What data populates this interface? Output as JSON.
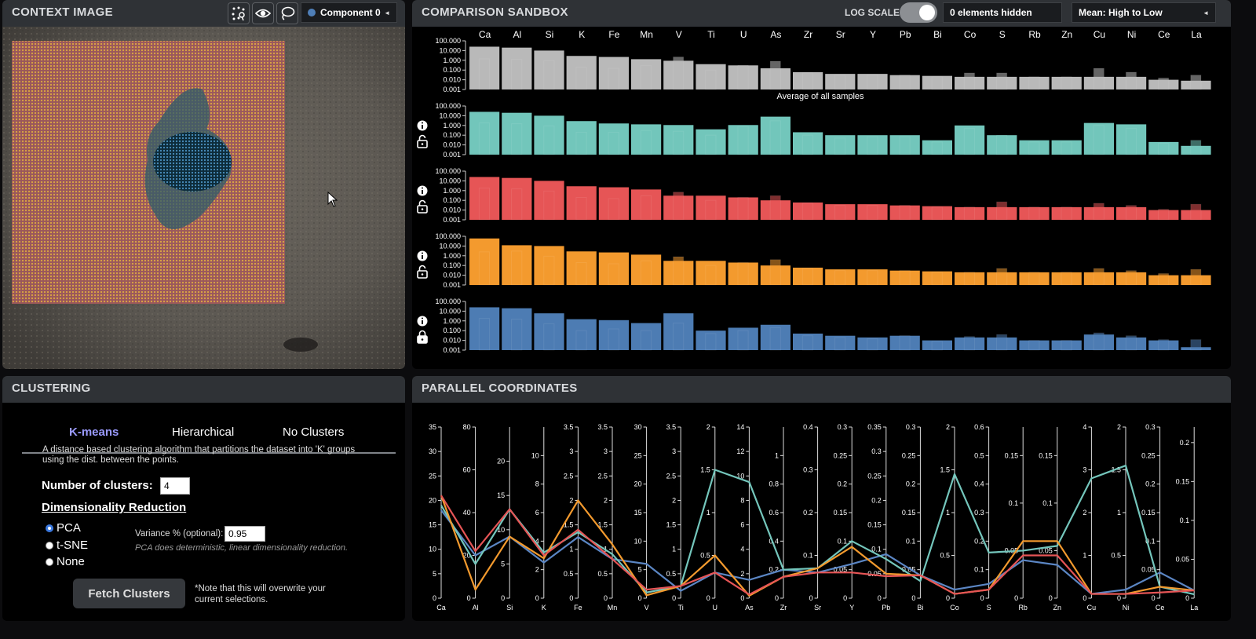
{
  "context": {
    "title": "CONTEXT IMAGE",
    "component_select": "Component 0",
    "component_color": "#4f7fb8"
  },
  "sandbox": {
    "title": "COMPARISON SANDBOX",
    "log_scale_label": "LOG SCALE",
    "log_scale_on": true,
    "hidden_label": "0 elements hidden",
    "sort_select": "Mean: High to Low",
    "avg_caption": "Average of all samples"
  },
  "clustering": {
    "title": "CLUSTERING",
    "tabs": [
      "K-means",
      "Hierarchical",
      "No Clusters"
    ],
    "active_tab": 0,
    "description": [
      "A distance based clustering algorithm that partitions the dataset into 'K' groups",
      "using the dist. between the points."
    ],
    "num_clusters_label": "Number of clusters:",
    "num_clusters_value": "4",
    "dimred_label": "Dimensionality Reduction",
    "options": [
      "PCA",
      "t-SNE",
      "None"
    ],
    "selected_option": 0,
    "variance_label": "Variance % (optional):",
    "variance_value": "0.95",
    "pca_note": "PCA does deterministic, linear dimensionality reduction.",
    "fetch_button": "Fetch Clusters",
    "note_lines": [
      "*Note that this will overwrite your",
      "current selections."
    ]
  },
  "parallel": {
    "title": "PARALLEL COORDINATES"
  },
  "chart_data": [
    {
      "type": "bar",
      "title": "COMPARISON SANDBOX",
      "log_scale": true,
      "y_ticks": [
        "100.000",
        "10.000",
        "1.000",
        "0.100",
        "0.010",
        "0.001"
      ],
      "ylim": [
        0.001,
        100
      ],
      "categories": [
        "Ca",
        "Al",
        "Si",
        "K",
        "Fe",
        "Mn",
        "V",
        "Ti",
        "U",
        "As",
        "Zr",
        "Sr",
        "Y",
        "Pb",
        "Bi",
        "Co",
        "S",
        "Rb",
        "Zn",
        "Cu",
        "Ni",
        "Ce",
        "La"
      ],
      "series": [
        {
          "color": "#b9b9b9",
          "mean": [
            25,
            20,
            10,
            2.8,
            2.2,
            1.3,
            0.9,
            0.4,
            0.3,
            0.15,
            0.06,
            0.04,
            0.04,
            0.03,
            0.025,
            0.02,
            0.02,
            0.02,
            0.02,
            0.02,
            0.02,
            0.01,
            0.008
          ],
          "inner": [
            1.4,
            1.2,
            0.9,
            0.2,
            0.15,
            0.3,
            2.2,
            0.1,
            0.3,
            0.8,
            0.05,
            0.03,
            0.03,
            0.03,
            0.02,
            0.05,
            0.05,
            0.02,
            0.02,
            0.15,
            0.06,
            0.015,
            0.03
          ]
        },
        {
          "color": "#72c6bb",
          "mean": [
            25,
            20,
            10,
            2.8,
            1.6,
            1.3,
            1.1,
            0.4,
            1.1,
            8,
            0.2,
            0.1,
            0.1,
            0.1,
            0.03,
            1,
            0.1,
            0.03,
            0.03,
            1.8,
            1.3,
            0.02,
            0.008
          ],
          "inner": [
            1.8,
            1.5,
            0.9,
            0.2,
            0.2,
            0.3,
            0.25,
            0.1,
            0.8,
            3,
            0.1,
            0.05,
            0.07,
            0.07,
            0.02,
            0.5,
            0.1,
            0.02,
            0.02,
            1,
            0.5,
            0.015,
            0.03
          ]
        },
        {
          "color": "#e65556",
          "mean": [
            25,
            20,
            10,
            2.8,
            2.2,
            1.3,
            0.3,
            0.3,
            0.2,
            0.1,
            0.06,
            0.04,
            0.04,
            0.03,
            0.025,
            0.02,
            0.02,
            0.02,
            0.02,
            0.02,
            0.02,
            0.01,
            0.01
          ],
          "inner": [
            1.8,
            1.5,
            0.9,
            0.2,
            0.15,
            0.3,
            0.7,
            0.1,
            0.2,
            0.3,
            0.05,
            0.03,
            0.03,
            0.03,
            0.02,
            0.02,
            0.07,
            0.02,
            0.02,
            0.05,
            0.03,
            0.012,
            0.04
          ]
        },
        {
          "color": "#f39a2e",
          "mean": [
            60,
            12,
            10,
            2.8,
            2.2,
            1.3,
            0.3,
            0.3,
            0.2,
            0.1,
            0.06,
            0.04,
            0.04,
            0.03,
            0.025,
            0.02,
            0.02,
            0.02,
            0.02,
            0.02,
            0.02,
            0.01,
            0.01
          ],
          "inner": [
            2.5,
            3,
            0.9,
            0.2,
            0.15,
            0.3,
            0.8,
            0.1,
            0.2,
            0.4,
            0.05,
            0.03,
            0.03,
            0.03,
            0.02,
            0.02,
            0.05,
            0.02,
            0.02,
            0.05,
            0.03,
            0.015,
            0.04
          ]
        },
        {
          "color": "#4d7cb3",
          "mean": [
            25,
            20,
            6,
            1.5,
            1.2,
            0.6,
            6,
            0.1,
            0.2,
            0.4,
            0.05,
            0.03,
            0.02,
            0.03,
            0.01,
            0.02,
            0.02,
            0.01,
            0.01,
            0.04,
            0.02,
            0.01,
            0.002
          ],
          "inner": [
            1.8,
            1.5,
            0.5,
            0.1,
            0.15,
            0.1,
            0.6,
            0.05,
            0.1,
            0.2,
            0.03,
            0.02,
            0.015,
            0.03,
            0.008,
            0.025,
            0.04,
            0.01,
            0.01,
            0.06,
            0.03,
            0.012,
            0.012
          ]
        }
      ]
    },
    {
      "type": "line",
      "title": "PARALLEL COORDINATES",
      "axes": [
        {
          "label": "Ca",
          "max": 35,
          "ticks": [
            35,
            30,
            25,
            20,
            15,
            10,
            5,
            0
          ]
        },
        {
          "label": "Al",
          "max": 80,
          "ticks": [
            80,
            60,
            40,
            20,
            0
          ]
        },
        {
          "label": "Si",
          "max": 25,
          "ticks": [
            20,
            15,
            10,
            5,
            0
          ]
        },
        {
          "label": "K",
          "max": 12,
          "ticks": [
            10,
            8,
            6,
            4,
            2,
            0
          ]
        },
        {
          "label": "Fe",
          "max": 3.5,
          "ticks": [
            3.5,
            3.0,
            2.5,
            2.0,
            1.5,
            1.0,
            0.5,
            0.0
          ]
        },
        {
          "label": "Mn",
          "max": 3.5,
          "ticks": [
            3.5,
            3.0,
            2.5,
            2.0,
            1.5,
            1.0,
            0.5,
            0.0
          ]
        },
        {
          "label": "V",
          "max": 30,
          "ticks": [
            30,
            25,
            20,
            15,
            10,
            5,
            0
          ]
        },
        {
          "label": "Ti",
          "max": 3.5,
          "ticks": [
            3.5,
            3.0,
            2.5,
            2.0,
            1.5,
            1.0,
            0.5,
            0.0
          ]
        },
        {
          "label": "U",
          "max": 2.0,
          "ticks": [
            2.0,
            1.5,
            1.0,
            0.5,
            0.0
          ]
        },
        {
          "label": "As",
          "max": 14,
          "ticks": [
            14,
            12,
            10,
            8,
            6,
            4,
            2,
            0
          ]
        },
        {
          "label": "Zr",
          "max": 1.2,
          "ticks": [
            1.0,
            0.8,
            0.6,
            0.4,
            0.2,
            0.0
          ]
        },
        {
          "label": "Sr",
          "max": 0.4,
          "ticks": [
            0.4,
            0.3,
            0.2,
            0.1,
            0.0
          ]
        },
        {
          "label": "Y",
          "max": 0.3,
          "ticks": [
            0.3,
            0.25,
            0.2,
            0.15,
            0.1,
            0.05,
            0.0
          ]
        },
        {
          "label": "Pb",
          "max": 0.35,
          "ticks": [
            0.35,
            0.3,
            0.25,
            0.2,
            0.15,
            0.1,
            0.05,
            0.0
          ]
        },
        {
          "label": "Bi",
          "max": 0.3,
          "ticks": [
            0.3,
            0.25,
            0.2,
            0.15,
            0.1,
            0.05,
            0.0
          ]
        },
        {
          "label": "Co",
          "max": 2.0,
          "ticks": [
            2.0,
            1.5,
            1.0,
            0.5,
            0.0
          ]
        },
        {
          "label": "S",
          "max": 0.6,
          "ticks": [
            0.6,
            0.5,
            0.4,
            0.3,
            0.2,
            0.1,
            0.0
          ]
        },
        {
          "label": "Rb",
          "max": 0.18,
          "ticks": [
            0.15,
            0.1,
            0.05,
            0.0
          ]
        },
        {
          "label": "Zn",
          "max": 0.18,
          "ticks": [
            0.15,
            0.1,
            0.05,
            0.0
          ]
        },
        {
          "label": "Cu",
          "max": 4,
          "ticks": [
            4,
            3,
            2,
            1,
            0
          ]
        },
        {
          "label": "Ni",
          "max": 2.0,
          "ticks": [
            2.0,
            1.5,
            1.0,
            0.5,
            0.0
          ]
        },
        {
          "label": "Ce",
          "max": 0.3,
          "ticks": [
            0.3,
            0.25,
            0.2,
            0.15,
            0.1,
            0.05,
            0.0
          ]
        },
        {
          "label": "La",
          "max": 0.22,
          "ticks": [
            0.2,
            0.15,
            0.1,
            0.05,
            0.0
          ]
        }
      ],
      "series": [
        {
          "color": "#5b86c4",
          "values": [
            18,
            20,
            9,
            2.5,
            1.25,
            0.8,
            6,
            0.15,
            0.3,
            1.5,
            0.2,
            0.06,
            0.06,
            0.09,
            0.04,
            0.1,
            0.05,
            0.04,
            0.035,
            0.1,
            0.1,
            0.045,
            0.01
          ]
        },
        {
          "color": "#74c6bc",
          "values": [
            19,
            16,
            13,
            3.2,
            1.35,
            0.9,
            1,
            0.25,
            1.5,
            9.5,
            0.2,
            0.07,
            0.1,
            0.08,
            0.03,
            1.45,
            0.16,
            0.05,
            0.055,
            2.8,
            1.55,
            0.02,
            0.005
          ]
        },
        {
          "color": "#f39a2e",
          "values": [
            21,
            4,
            9,
            2.8,
            2.0,
            1.1,
            0.5,
            0.25,
            0.5,
            0.2,
            0.15,
            0.07,
            0.09,
            0.05,
            0.04,
            0.05,
            0.03,
            0.06,
            0.06,
            0.1,
            0.05,
            0.02,
            0.01
          ]
        },
        {
          "color": "#e65556",
          "values": [
            21,
            22,
            13,
            3,
            1.4,
            0.8,
            1.5,
            0.25,
            0.3,
            0.3,
            0.15,
            0.06,
            0.045,
            0.045,
            0.04,
            0.05,
            0.03,
            0.045,
            0.045,
            0.1,
            0.05,
            0.01,
            0.01
          ]
        }
      ]
    }
  ]
}
